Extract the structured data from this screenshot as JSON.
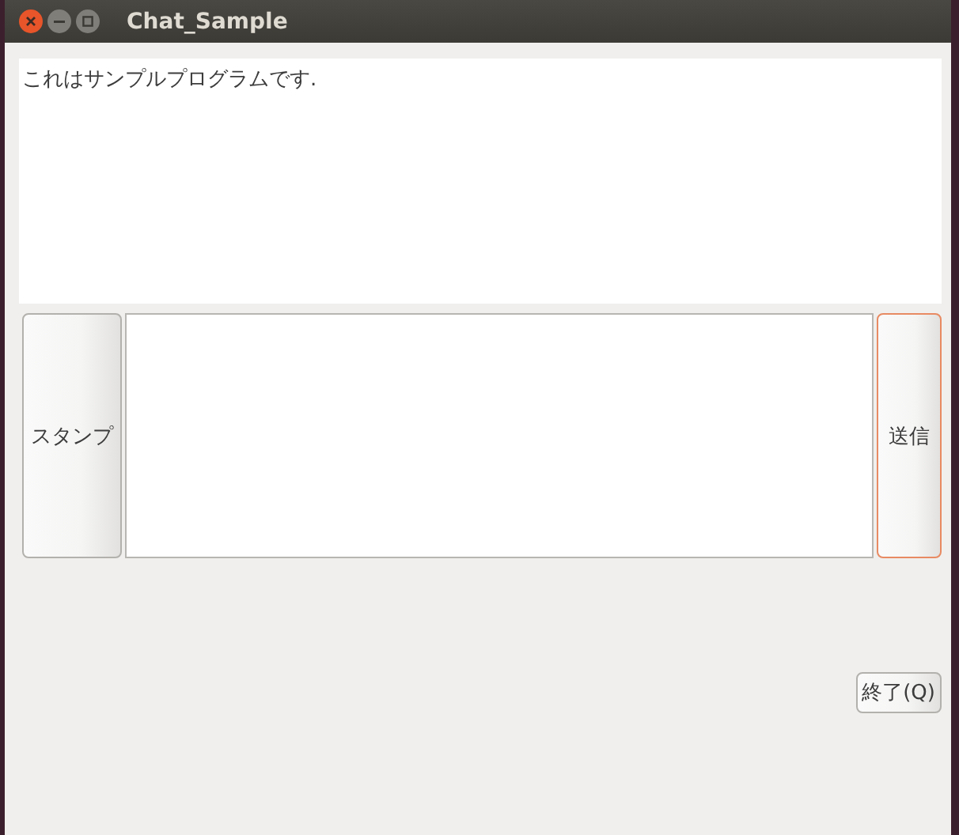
{
  "window": {
    "title": "Chat_Sample"
  },
  "log": {
    "text": "これはサンプルプログラムです."
  },
  "stamp_button": {
    "label": "スタンプ",
    "focused": false
  },
  "send_button": {
    "label": "送信",
    "focused": true
  },
  "quit_button": {
    "label": "終了(Q)",
    "focused": false
  }
}
